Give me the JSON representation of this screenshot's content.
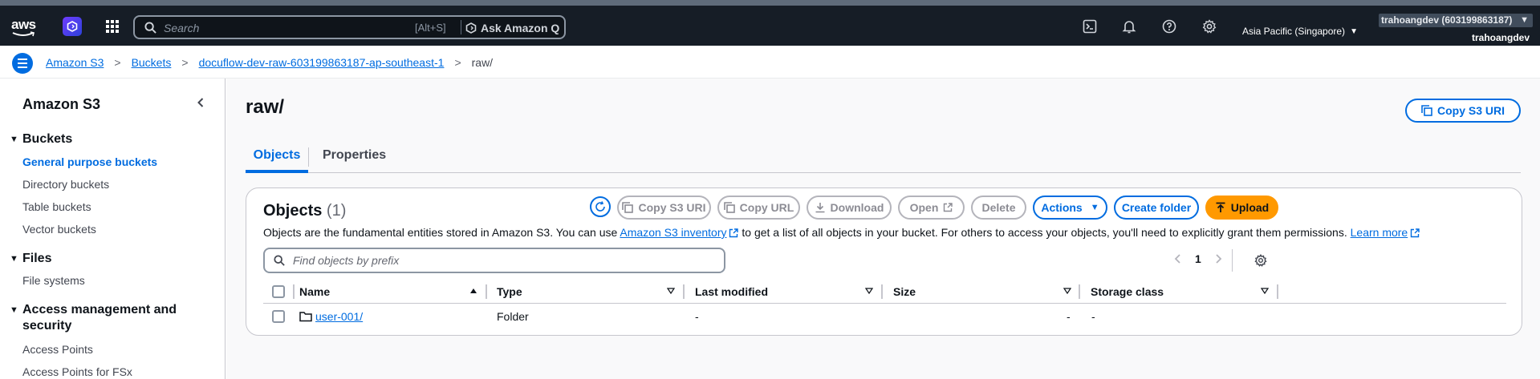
{
  "topnav": {
    "logo_text": "aws",
    "search_placeholder": "Search",
    "search_shortcut": "[Alt+S]",
    "ask_q_label": "Ask Amazon Q",
    "region": "Asia Pacific (Singapore)",
    "account": "trahoangdev (603199863187)",
    "username": "trahoangdev"
  },
  "breadcrumb": {
    "items": [
      "Amazon S3",
      "Buckets",
      "docuflow-dev-raw-603199863187-ap-southeast-1"
    ],
    "current": "raw/"
  },
  "sidenav": {
    "title": "Amazon S3",
    "sections": [
      {
        "label": "Buckets",
        "items": [
          "General purpose buckets",
          "Directory buckets",
          "Table buckets",
          "Vector buckets"
        ]
      },
      {
        "label": "Files",
        "items": [
          "File systems"
        ]
      },
      {
        "label": "Access management and security",
        "items": [
          "Access Points",
          "Access Points for FSx"
        ]
      }
    ]
  },
  "page": {
    "title": "raw/",
    "copy_s3_uri_label": "Copy S3 URI",
    "tabs": [
      "Objects",
      "Properties"
    ]
  },
  "objects": {
    "title": "Objects",
    "count": "(1)",
    "desc_before": "Objects are the fundamental entities stored in Amazon S3. You can use ",
    "desc_link": "Amazon S3 inventory",
    "desc_after": " to get a list of all objects in your bucket. For others to access your objects, you'll need to explicitly grant them permissions. ",
    "learn_more": "Learn more",
    "buttons": {
      "copy_s3_uri": "Copy S3 URI",
      "copy_url": "Copy URL",
      "download": "Download",
      "open": "Open",
      "delete": "Delete",
      "actions": "Actions",
      "create_folder": "Create folder",
      "upload": "Upload"
    },
    "filter_placeholder": "Find objects by prefix",
    "page_number": "1",
    "columns": [
      "Name",
      "Type",
      "Last modified",
      "Size",
      "Storage class"
    ],
    "rows": [
      {
        "name": "user-001/",
        "type": "Folder",
        "last_modified": "-",
        "size": "-",
        "storage_class": "-"
      }
    ]
  },
  "colors": {
    "accent": "#006ce0",
    "upload": "#ff9900",
    "topbar": "#161d26"
  }
}
